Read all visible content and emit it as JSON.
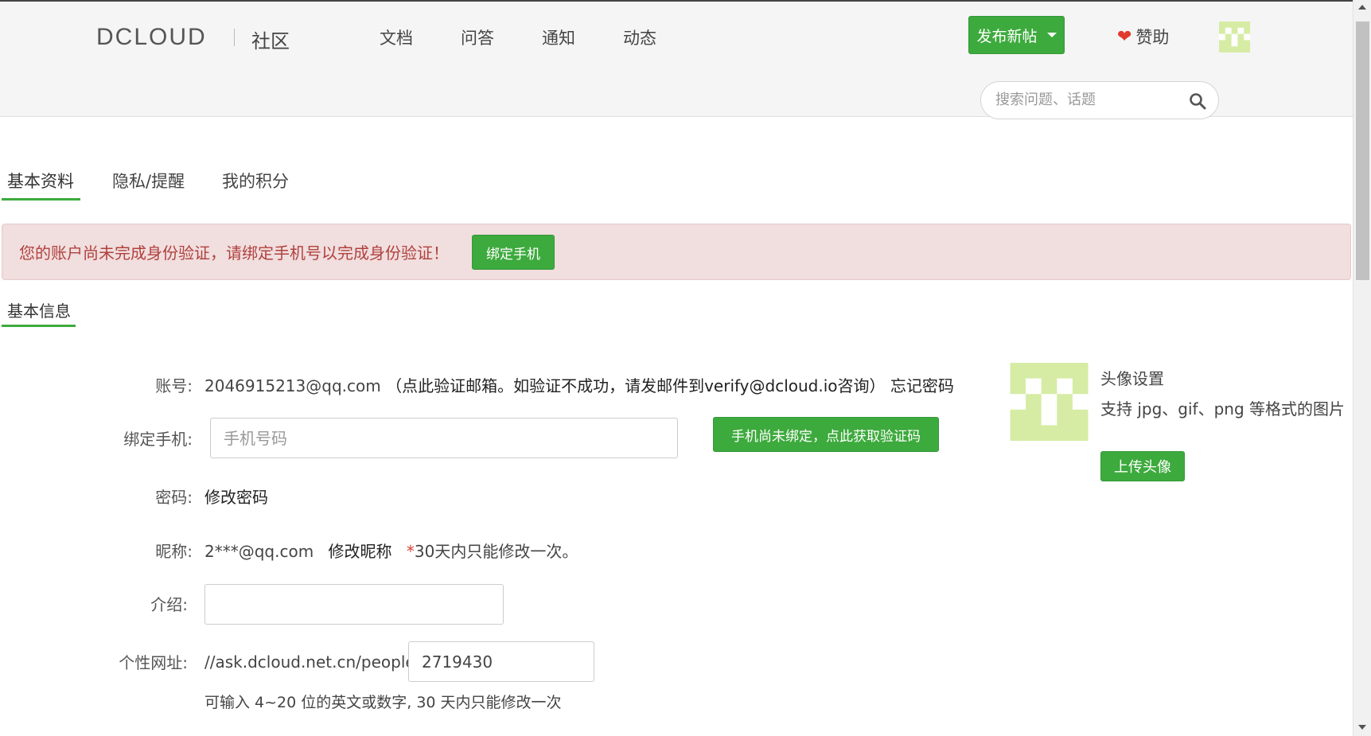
{
  "header": {
    "logo": "DCLOUD",
    "logo_sub": "社区",
    "nav": [
      "文档",
      "问答",
      "通知",
      "动态"
    ],
    "post_button": "发布新帖",
    "sponsor": "赞助",
    "search_placeholder": "搜索问题、话题"
  },
  "tabs": [
    "基本资料",
    "隐私/提醒",
    "我的积分"
  ],
  "alert": {
    "text": "您的账户尚未完成身份验证，请绑定手机号以完成身份验证！",
    "button": "绑定手机"
  },
  "section_title": "基本信息",
  "form": {
    "account": {
      "label": "账号:",
      "value": "2046915213@qq.com",
      "verify_text": "（点此验证邮箱。如验证不成功，请发邮件到verify@dcloud.io咨询）",
      "forgot": "忘记密码"
    },
    "phone": {
      "label": "绑定手机:",
      "placeholder": "手机号码",
      "button": "手机尚未绑定，点此获取验证码"
    },
    "password": {
      "label": "密码:",
      "link": "修改密码"
    },
    "nickname": {
      "label": "昵称:",
      "value": "2***@qq.com",
      "link": "修改昵称",
      "note_star": "*",
      "note": "30天内只能修改一次。"
    },
    "intro": {
      "label": "介绍:",
      "value": ""
    },
    "url": {
      "label": "个性网址:",
      "prefix": "//ask.dcloud.net.cn/people/",
      "value": "2719430",
      "hint": "可输入 4~20 位的英文或数字, 30 天内只能修改一次"
    }
  },
  "avatar_panel": {
    "title": "头像设置",
    "hint": "支持 jpg、gif、png 等格式的图片",
    "button": "上传头像"
  },
  "colors": {
    "accent_green": "#3daa3d",
    "alert_bg": "#f1dede",
    "alert_text": "#b0413e",
    "avatar_green": "#d6eca5"
  }
}
